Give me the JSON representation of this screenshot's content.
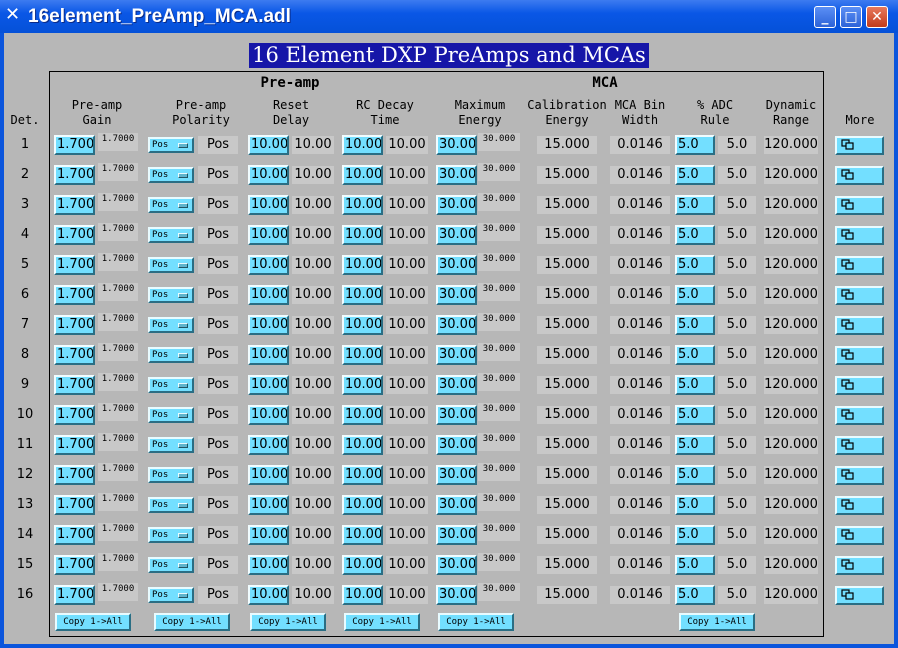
{
  "window": {
    "title": "16element_PreAmp_MCA.adl",
    "banner": "16 Element DXP PreAmps and MCAs"
  },
  "sections": {
    "preamp": "Pre-amp",
    "mca": "MCA"
  },
  "headers": {
    "det": "Det.",
    "gain": [
      "Pre-amp",
      "Gain"
    ],
    "polarity": [
      "Pre-amp",
      "Polarity"
    ],
    "reset": [
      "Reset",
      "Delay"
    ],
    "rc": [
      "RC Decay",
      "Time"
    ],
    "maxe": [
      "Maximum",
      "Energy"
    ],
    "calib": [
      "Calibration",
      "Energy"
    ],
    "binw": [
      "MCA Bin",
      "Width"
    ],
    "adc": [
      "% ADC",
      "Rule"
    ],
    "dyn": [
      "Dynamic",
      "Range"
    ],
    "more": "More"
  },
  "rows": [
    {
      "det": "1",
      "gain_set": "1.700",
      "gain_rbv": "1.7000",
      "pol_set": "Pos",
      "pol_rbv": "Pos",
      "reset_set": "10.00",
      "reset_rbv": "10.00",
      "rc_set": "10.00",
      "rc_rbv": "10.00",
      "maxe_set": "30.00",
      "maxe_rbv": "30.000",
      "calib": "15.000",
      "binw": "0.0146",
      "adc_set": "5.0",
      "adc_rbv": "5.0",
      "dyn": "120.000"
    },
    {
      "det": "2",
      "gain_set": "1.700",
      "gain_rbv": "1.7000",
      "pol_set": "Pos",
      "pol_rbv": "Pos",
      "reset_set": "10.00",
      "reset_rbv": "10.00",
      "rc_set": "10.00",
      "rc_rbv": "10.00",
      "maxe_set": "30.00",
      "maxe_rbv": "30.000",
      "calib": "15.000",
      "binw": "0.0146",
      "adc_set": "5.0",
      "adc_rbv": "5.0",
      "dyn": "120.000"
    },
    {
      "det": "3",
      "gain_set": "1.700",
      "gain_rbv": "1.7000",
      "pol_set": "Pos",
      "pol_rbv": "Pos",
      "reset_set": "10.00",
      "reset_rbv": "10.00",
      "rc_set": "10.00",
      "rc_rbv": "10.00",
      "maxe_set": "30.00",
      "maxe_rbv": "30.000",
      "calib": "15.000",
      "binw": "0.0146",
      "adc_set": "5.0",
      "adc_rbv": "5.0",
      "dyn": "120.000"
    },
    {
      "det": "4",
      "gain_set": "1.700",
      "gain_rbv": "1.7000",
      "pol_set": "Pos",
      "pol_rbv": "Pos",
      "reset_set": "10.00",
      "reset_rbv": "10.00",
      "rc_set": "10.00",
      "rc_rbv": "10.00",
      "maxe_set": "30.00",
      "maxe_rbv": "30.000",
      "calib": "15.000",
      "binw": "0.0146",
      "adc_set": "5.0",
      "adc_rbv": "5.0",
      "dyn": "120.000"
    },
    {
      "det": "5",
      "gain_set": "1.700",
      "gain_rbv": "1.7000",
      "pol_set": "Pos",
      "pol_rbv": "Pos",
      "reset_set": "10.00",
      "reset_rbv": "10.00",
      "rc_set": "10.00",
      "rc_rbv": "10.00",
      "maxe_set": "30.00",
      "maxe_rbv": "30.000",
      "calib": "15.000",
      "binw": "0.0146",
      "adc_set": "5.0",
      "adc_rbv": "5.0",
      "dyn": "120.000"
    },
    {
      "det": "6",
      "gain_set": "1.700",
      "gain_rbv": "1.7000",
      "pol_set": "Pos",
      "pol_rbv": "Pos",
      "reset_set": "10.00",
      "reset_rbv": "10.00",
      "rc_set": "10.00",
      "rc_rbv": "10.00",
      "maxe_set": "30.00",
      "maxe_rbv": "30.000",
      "calib": "15.000",
      "binw": "0.0146",
      "adc_set": "5.0",
      "adc_rbv": "5.0",
      "dyn": "120.000"
    },
    {
      "det": "7",
      "gain_set": "1.700",
      "gain_rbv": "1.7000",
      "pol_set": "Pos",
      "pol_rbv": "Pos",
      "reset_set": "10.00",
      "reset_rbv": "10.00",
      "rc_set": "10.00",
      "rc_rbv": "10.00",
      "maxe_set": "30.00",
      "maxe_rbv": "30.000",
      "calib": "15.000",
      "binw": "0.0146",
      "adc_set": "5.0",
      "adc_rbv": "5.0",
      "dyn": "120.000"
    },
    {
      "det": "8",
      "gain_set": "1.700",
      "gain_rbv": "1.7000",
      "pol_set": "Pos",
      "pol_rbv": "Pos",
      "reset_set": "10.00",
      "reset_rbv": "10.00",
      "rc_set": "10.00",
      "rc_rbv": "10.00",
      "maxe_set": "30.00",
      "maxe_rbv": "30.000",
      "calib": "15.000",
      "binw": "0.0146",
      "adc_set": "5.0",
      "adc_rbv": "5.0",
      "dyn": "120.000"
    },
    {
      "det": "9",
      "gain_set": "1.700",
      "gain_rbv": "1.7000",
      "pol_set": "Pos",
      "pol_rbv": "Pos",
      "reset_set": "10.00",
      "reset_rbv": "10.00",
      "rc_set": "10.00",
      "rc_rbv": "10.00",
      "maxe_set": "30.00",
      "maxe_rbv": "30.000",
      "calib": "15.000",
      "binw": "0.0146",
      "adc_set": "5.0",
      "adc_rbv": "5.0",
      "dyn": "120.000"
    },
    {
      "det": "10",
      "gain_set": "1.700",
      "gain_rbv": "1.7000",
      "pol_set": "Pos",
      "pol_rbv": "Pos",
      "reset_set": "10.00",
      "reset_rbv": "10.00",
      "rc_set": "10.00",
      "rc_rbv": "10.00",
      "maxe_set": "30.00",
      "maxe_rbv": "30.000",
      "calib": "15.000",
      "binw": "0.0146",
      "adc_set": "5.0",
      "adc_rbv": "5.0",
      "dyn": "120.000"
    },
    {
      "det": "11",
      "gain_set": "1.700",
      "gain_rbv": "1.7000",
      "pol_set": "Pos",
      "pol_rbv": "Pos",
      "reset_set": "10.00",
      "reset_rbv": "10.00",
      "rc_set": "10.00",
      "rc_rbv": "10.00",
      "maxe_set": "30.00",
      "maxe_rbv": "30.000",
      "calib": "15.000",
      "binw": "0.0146",
      "adc_set": "5.0",
      "adc_rbv": "5.0",
      "dyn": "120.000"
    },
    {
      "det": "12",
      "gain_set": "1.700",
      "gain_rbv": "1.7000",
      "pol_set": "Pos",
      "pol_rbv": "Pos",
      "reset_set": "10.00",
      "reset_rbv": "10.00",
      "rc_set": "10.00",
      "rc_rbv": "10.00",
      "maxe_set": "30.00",
      "maxe_rbv": "30.000",
      "calib": "15.000",
      "binw": "0.0146",
      "adc_set": "5.0",
      "adc_rbv": "5.0",
      "dyn": "120.000"
    },
    {
      "det": "13",
      "gain_set": "1.700",
      "gain_rbv": "1.7000",
      "pol_set": "Pos",
      "pol_rbv": "Pos",
      "reset_set": "10.00",
      "reset_rbv": "10.00",
      "rc_set": "10.00",
      "rc_rbv": "10.00",
      "maxe_set": "30.00",
      "maxe_rbv": "30.000",
      "calib": "15.000",
      "binw": "0.0146",
      "adc_set": "5.0",
      "adc_rbv": "5.0",
      "dyn": "120.000"
    },
    {
      "det": "14",
      "gain_set": "1.700",
      "gain_rbv": "1.7000",
      "pol_set": "Pos",
      "pol_rbv": "Pos",
      "reset_set": "10.00",
      "reset_rbv": "10.00",
      "rc_set": "10.00",
      "rc_rbv": "10.00",
      "maxe_set": "30.00",
      "maxe_rbv": "30.000",
      "calib": "15.000",
      "binw": "0.0146",
      "adc_set": "5.0",
      "adc_rbv": "5.0",
      "dyn": "120.000"
    },
    {
      "det": "15",
      "gain_set": "1.700",
      "gain_rbv": "1.7000",
      "pol_set": "Pos",
      "pol_rbv": "Pos",
      "reset_set": "10.00",
      "reset_rbv": "10.00",
      "rc_set": "10.00",
      "rc_rbv": "10.00",
      "maxe_set": "30.00",
      "maxe_rbv": "30.000",
      "calib": "15.000",
      "binw": "0.0146",
      "adc_set": "5.0",
      "adc_rbv": "5.0",
      "dyn": "120.000"
    },
    {
      "det": "16",
      "gain_set": "1.700",
      "gain_rbv": "1.7000",
      "pol_set": "Pos",
      "pol_rbv": "Pos",
      "reset_set": "10.00",
      "reset_rbv": "10.00",
      "rc_set": "10.00",
      "rc_rbv": "10.00",
      "maxe_set": "30.00",
      "maxe_rbv": "30.000",
      "calib": "15.000",
      "binw": "0.0146",
      "adc_set": "5.0",
      "adc_rbv": "5.0",
      "dyn": "120.000"
    }
  ],
  "copy_all_label": "Copy 1->All",
  "icons": {
    "app": "x-app-icon",
    "more": "related-display-icon",
    "window_buttons": [
      "minimize-icon",
      "maximize-icon",
      "close-icon"
    ]
  },
  "colors": {
    "background": "#b7b7b7",
    "control": "#73dfff",
    "banner_bg": "#1616a8",
    "banner_fg": "#ffffff",
    "titlebar": "#0a57e6"
  }
}
